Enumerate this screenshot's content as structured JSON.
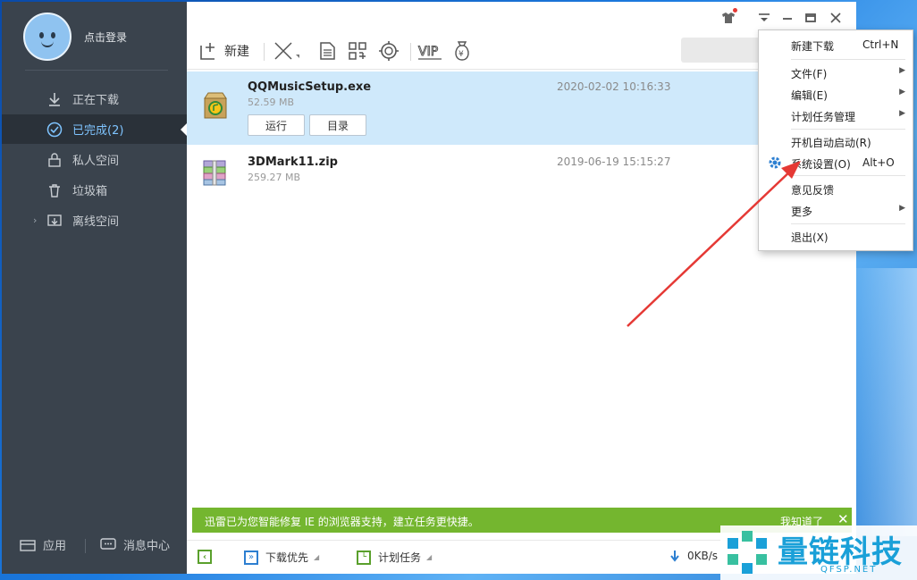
{
  "sidebar": {
    "login_label": "点击登录",
    "items": [
      {
        "label": "正在下载",
        "icon": "download-icon"
      },
      {
        "label": "已完成(2)",
        "icon": "check-circle-icon"
      },
      {
        "label": "私人空间",
        "icon": "lock-icon"
      },
      {
        "label": "垃圾箱",
        "icon": "trash-icon"
      },
      {
        "label": "离线空间",
        "icon": "cloud-download-icon"
      }
    ],
    "bottom": {
      "apps_label": "应用",
      "messages_label": "消息中心"
    }
  },
  "toolbar": {
    "new_label": "新建"
  },
  "files": [
    {
      "name": "QQMusicSetup.exe",
      "size": "52.59 MB",
      "date": "2020-02-02 10:16:33",
      "run_label": "运行",
      "dir_label": "目录"
    },
    {
      "name": "3DMark11.zip",
      "size": "259.27 MB",
      "date": "2019-06-19 15:15:27"
    }
  ],
  "notice": {
    "text": "迅雷已为您智能修复 IE 的浏览器支持，建立任务更快捷。",
    "ok_label": "我知道了",
    "close_glyph": "✕"
  },
  "status": {
    "priority_label": "下载优先",
    "schedule_label": "计划任务",
    "speed": "0KB/s"
  },
  "menu": {
    "items": [
      {
        "label": "新建下载",
        "shortcut": "Ctrl+N"
      },
      {
        "label": "文件(F)",
        "submenu": true
      },
      {
        "label": "编辑(E)",
        "submenu": true
      },
      {
        "label": "计划任务管理",
        "submenu": true
      },
      {
        "label": "开机自动启动(R)"
      },
      {
        "label": "系统设置(O)",
        "shortcut": "Alt+O",
        "icon": "gear-icon"
      },
      {
        "label": "意见反馈"
      },
      {
        "label": "更多",
        "submenu": true
      },
      {
        "label": "退出(X)"
      }
    ]
  },
  "watermark": {
    "brand": "量链科技",
    "site": "QFSP.NET"
  },
  "colors": {
    "sidebar": "#3a434d",
    "accent": "#2d7fd1",
    "notice": "#74b62f",
    "selected_row": "#cfe9fb",
    "arrow": "#e53935"
  }
}
